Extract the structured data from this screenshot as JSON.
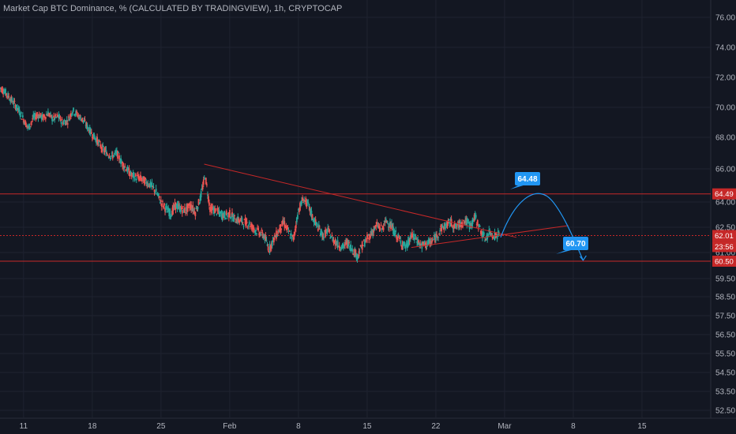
{
  "chart_title": "Market Cap BTC Dominance, % (CALCULATED BY TRADINGVIEW), 1h, CRYPTOCAP",
  "colors": {
    "background": "#131722",
    "grid": "#1f2330",
    "axis_text": "#b2b5be",
    "up": "#26a69a",
    "down": "#ef5350",
    "level_line": "#c62828",
    "trendline": "#c62828",
    "projection": "#2196f3",
    "label_bg": "#2196f3"
  },
  "chart_data": {
    "type": "line",
    "title": "Market Cap BTC Dominance, % (CALCULATED BY TRADINGVIEW), 1h, CRYPTOCAP",
    "ylim": [
      52.2,
      76.3
    ],
    "y_ticks": [
      "76.00",
      "74.00",
      "72.00",
      "70.00",
      "68.00",
      "66.00",
      "64.00",
      "62.50",
      "61.00",
      "59.50",
      "58.50",
      "57.50",
      "56.50",
      "55.50",
      "54.50",
      "53.50",
      "52.50"
    ],
    "y_tick_values": [
      76,
      74,
      72,
      70,
      68,
      66,
      64,
      62.5,
      61,
      59.5,
      58.5,
      57.5,
      56.5,
      55.5,
      54.5,
      53.5,
      52.5
    ],
    "x_ticks": [
      "11",
      "18",
      "25",
      "Feb",
      "8",
      "15",
      "22",
      "Mar",
      "8",
      "15"
    ],
    "x_tick_days": [
      0,
      7,
      14,
      21,
      28,
      35,
      42,
      49,
      56,
      63
    ],
    "xlim_days": [
      -2.5,
      72.5
    ],
    "series": [
      {
        "values": [
          [
            -2.4,
            71.3
          ],
          [
            -2,
            71.1
          ],
          [
            -1.5,
            70.7
          ],
          [
            -1,
            70.3
          ],
          [
            -0.5,
            69.8
          ],
          [
            0,
            69.2
          ],
          [
            0.5,
            68.6
          ],
          [
            1,
            69.3
          ],
          [
            1.5,
            69.5
          ],
          [
            2,
            69.3
          ],
          [
            2.5,
            69.6
          ],
          [
            3,
            69.2
          ],
          [
            3.5,
            69.4
          ],
          [
            4,
            69.0
          ],
          [
            4.5,
            69.1
          ],
          [
            5,
            69.8
          ],
          [
            5.5,
            69.5
          ],
          [
            6,
            69.2
          ],
          [
            6.5,
            68.7
          ],
          [
            7,
            68.2
          ],
          [
            7.5,
            67.8
          ],
          [
            8,
            67.3
          ],
          [
            8.5,
            67.0
          ],
          [
            9,
            66.8
          ],
          [
            9.5,
            67.0
          ],
          [
            10,
            66.4
          ],
          [
            10.5,
            66.0
          ],
          [
            11,
            65.6
          ],
          [
            11.5,
            65.5
          ],
          [
            12,
            65.4
          ],
          [
            12.5,
            65.2
          ],
          [
            13,
            65.0
          ],
          [
            13.5,
            64.6
          ],
          [
            14,
            64.0
          ],
          [
            14.5,
            63.6
          ],
          [
            15,
            63.3
          ],
          [
            15.5,
            63.8
          ],
          [
            16,
            63.6
          ],
          [
            16.5,
            63.5
          ],
          [
            17,
            63.8
          ],
          [
            17.5,
            63.4
          ],
          [
            18,
            64.2
          ],
          [
            18.5,
            65.6
          ],
          [
            19,
            63.6
          ],
          [
            19.5,
            63.5
          ],
          [
            20,
            63.3
          ],
          [
            20.5,
            63.2
          ],
          [
            21,
            63.3
          ],
          [
            21.5,
            63.0
          ],
          [
            22,
            62.9
          ],
          [
            22.5,
            62.8
          ],
          [
            23,
            62.7
          ],
          [
            23.5,
            62.4
          ],
          [
            24,
            62.2
          ],
          [
            24.5,
            62.0
          ],
          [
            25,
            61.2
          ],
          [
            25.5,
            61.8
          ],
          [
            26,
            62.3
          ],
          [
            26.5,
            62.8
          ],
          [
            27,
            62.2
          ],
          [
            27.5,
            61.8
          ],
          [
            28,
            63.5
          ],
          [
            28.5,
            64.2
          ],
          [
            29,
            63.8
          ],
          [
            29.5,
            63.0
          ],
          [
            30,
            62.5
          ],
          [
            30.5,
            62.0
          ],
          [
            31,
            62.3
          ],
          [
            31.5,
            61.8
          ],
          [
            32,
            61.5
          ],
          [
            32.5,
            61.3
          ],
          [
            33,
            61.6
          ],
          [
            33.5,
            61.2
          ],
          [
            34,
            60.8
          ],
          [
            34.5,
            61.4
          ],
          [
            35,
            61.8
          ],
          [
            35.5,
            62.2
          ],
          [
            36,
            62.6
          ],
          [
            36.5,
            62.4
          ],
          [
            37,
            62.9
          ],
          [
            37.5,
            62.5
          ],
          [
            38,
            62.0
          ],
          [
            38.5,
            61.6
          ],
          [
            39,
            61.3
          ],
          [
            39.5,
            62.0
          ],
          [
            40,
            61.8
          ],
          [
            40.5,
            61.4
          ],
          [
            41,
            61.5
          ],
          [
            41.5,
            61.6
          ],
          [
            42,
            61.9
          ],
          [
            42.5,
            62.4
          ],
          [
            43,
            62.6
          ],
          [
            43.5,
            62.8
          ],
          [
            44,
            62.5
          ],
          [
            44.5,
            62.7
          ],
          [
            45,
            62.9
          ],
          [
            45.5,
            62.6
          ],
          [
            46,
            63.1
          ],
          [
            46.5,
            62.4
          ],
          [
            47,
            61.8
          ],
          [
            47.5,
            62.2
          ],
          [
            48,
            62.0
          ],
          [
            48.5,
            62.1
          ]
        ],
        "note": "price"
      }
    ],
    "annotations": {
      "horizontal_levels": [
        64.49,
        62.01,
        60.5
      ],
      "price_labels": [
        "64.49",
        "62.01",
        "23:56",
        "60.50"
      ],
      "callouts": [
        "64.48",
        "60.70"
      ]
    },
    "grid": true
  }
}
